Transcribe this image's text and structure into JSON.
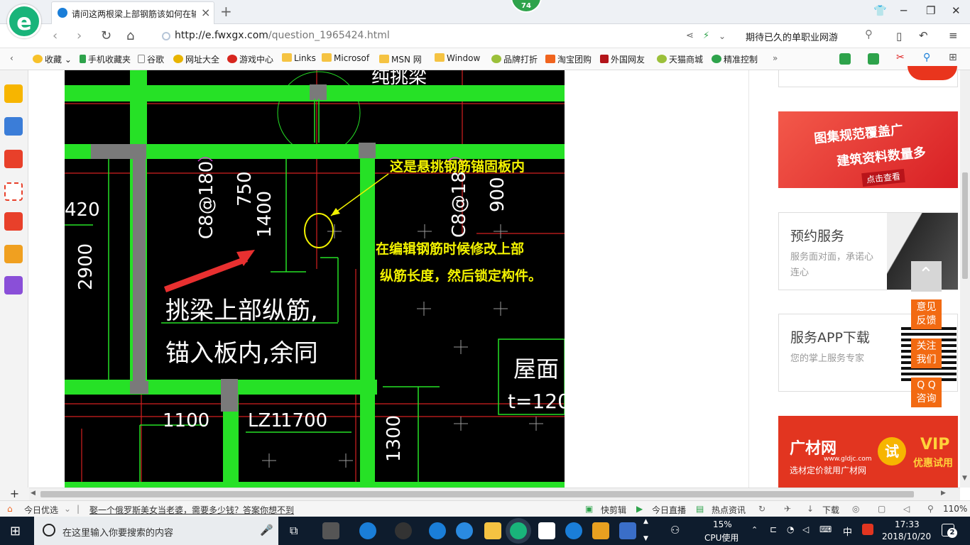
{
  "browser": {
    "tab_title": "请问这两根梁上部钢筋该如何在输",
    "badge_value": "74",
    "url_host": "http://e.fwxgx.com",
    "url_path": "/question_1965424.html",
    "search_text": "期待已久的单职业网游"
  },
  "bookmarks": [
    {
      "label": "收藏",
      "icon": "star-icon"
    },
    {
      "label": "手机收藏夹",
      "icon": "phone-icon"
    },
    {
      "label": "谷歌",
      "icon": "page-icon"
    },
    {
      "label": "网址大全",
      "icon": "globe-icon"
    },
    {
      "label": "游戏中心",
      "icon": "game-icon"
    },
    {
      "label": "Links",
      "icon": "folder-icon"
    },
    {
      "label": "Microsof",
      "icon": "folder-icon"
    },
    {
      "label": "MSN 网",
      "icon": "folder-icon"
    },
    {
      "label": "Window",
      "icon": "folder-icon"
    },
    {
      "label": "品牌打折",
      "icon": "leaf-icon"
    },
    {
      "label": "淘宝团购",
      "icon": "taobao-icon"
    },
    {
      "label": "外国网友",
      "icon": "flag-icon"
    },
    {
      "label": "天猫商城",
      "icon": "leaf-icon"
    },
    {
      "label": "精准控制",
      "icon": "chat-icon"
    }
  ],
  "cad": {
    "labels": {
      "yellow_note_1": "这是悬挑钢筋锚固板内",
      "yellow_note_2": "在编辑钢筋时候修改上部",
      "yellow_note_3": "纵筋长度，然后锁定构件。",
      "white_note_1": "挑梁上部纵筋,",
      "white_note_2": "锚入板内,余同",
      "top_partial": "纯挑梁",
      "dim_420": "420",
      "dim_2900": "2900",
      "rebar_1": "C8@180",
      "dim_750": "750",
      "dim_1400": "1400",
      "rebar_2": "C8@18",
      "dim_900": "900",
      "roof": "屋面",
      "thickness": "t=120",
      "dim_1100": "1100",
      "lz": "LZ1",
      "dim_1700": "1700",
      "dim_1300": "1300"
    }
  },
  "right_panel": {
    "ad1_line1": "图集规范覆盖广",
    "ad1_line2": "建筑资料数量多",
    "ad1_link": "点击查看",
    "card1_title": "预约服务",
    "card1_sub": "服务面对面，承诺心连心",
    "card2_title": "服务APP下载",
    "card2_sub": "您的掌上服务专家",
    "ad2_brand": "广材网",
    "ad2_domain": "www.gldjc.com",
    "ad2_slogan": "选材定价就用广材网",
    "ad2_try": "试",
    "ad2_vip": "VIP",
    "ad2_vip_sub": "优惠试用"
  },
  "float_buttons": {
    "feedback": [
      "意见",
      "反馈"
    ],
    "follow": [
      "关注",
      "我们"
    ],
    "qq": [
      "Q Q",
      "咨询"
    ]
  },
  "status": {
    "today": "今日优选",
    "headline": "娶一个俄罗斯美女当老婆，需要多少钱？答案你想不到",
    "quickcut": "快剪辑",
    "live": "今日直播",
    "news": "热点资讯",
    "download": "下载",
    "zoom": "110%"
  },
  "taskbar": {
    "search_placeholder": "在这里输入你要搜索的内容",
    "cpu_percent": "15%",
    "cpu_label": "CPU使用",
    "ime": "中",
    "time": "17:33",
    "date": "2018/10/20",
    "notifications": "2"
  }
}
